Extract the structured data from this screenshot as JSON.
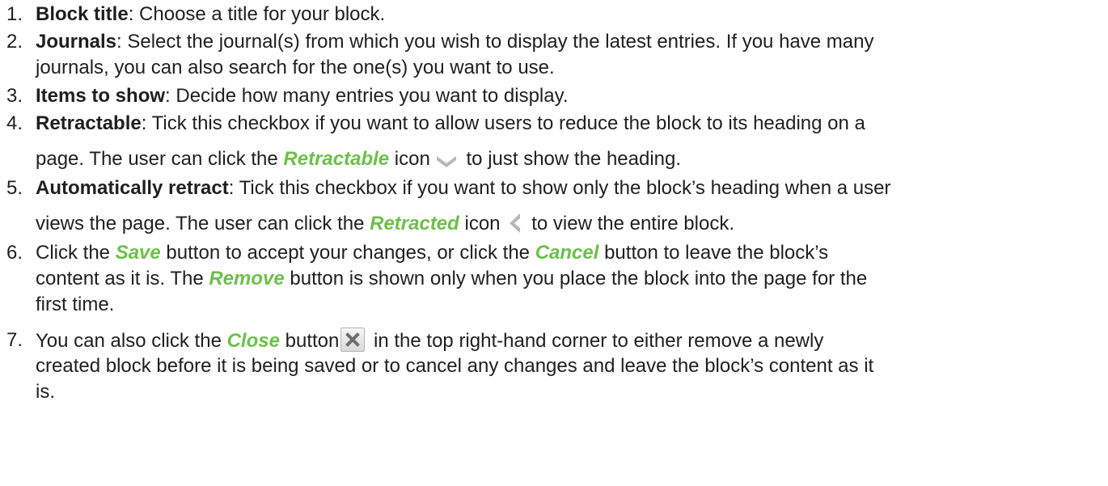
{
  "items": [
    {
      "number": "1.",
      "term": "Block title",
      "line1": ": Choose a title for your block."
    },
    {
      "number": "2.",
      "term": "Journals",
      "line1": ": Select the journal(s) from which you wish to display the latest entries. If you have many",
      "line2": "journals, you can also search for the one(s) you want to use."
    },
    {
      "number": "3.",
      "term": "Items to show",
      "line1": ": Decide how many entries you want to display."
    },
    {
      "number": "4.",
      "term": "Retractable",
      "line1": ": Tick this checkbox if you want to allow users to reduce the block to its heading on a",
      "line2_pre": "page. The user can click the ",
      "ui_term": "Retractable",
      "line2_mid": " icon",
      "icon": "chevron-down-icon",
      "line2_post": " to just show the heading."
    },
    {
      "number": "5.",
      "term": "Automatically retract",
      "line1": ": Tick this checkbox if you want to show only the block’s heading when a user",
      "line2_pre": "views the page. The user can click the ",
      "ui_term": "Retracted",
      "line2_mid": " icon",
      "icon": "chevron-left-icon",
      "line2_post": " to view the entire block."
    },
    {
      "number": "6.",
      "l1_a": "Click the ",
      "save": "Save",
      "l1_b": " button to accept your changes, or click the ",
      "cancel": "Cancel",
      "l1_c": " button to leave the block’s",
      "l2_a": "content as it is. The ",
      "remove": "Remove",
      "l2_b": " button is shown only when you place the block into the page for the",
      "l3": "first time."
    },
    {
      "number": "7.",
      "l1_a": "You can also click the ",
      "close": "Close",
      "l1_b": " button",
      "icon": "close-icon",
      "l1_c": " in the top right-hand corner to either remove a newly",
      "l2": "created block before it is being saved or to cancel any changes and leave the block’s content as it",
      "l3": "is."
    }
  ],
  "colors": {
    "ui_term": "#6cc04a",
    "text": "#1f1f1f",
    "icon_gray": "#b8b8b8"
  }
}
